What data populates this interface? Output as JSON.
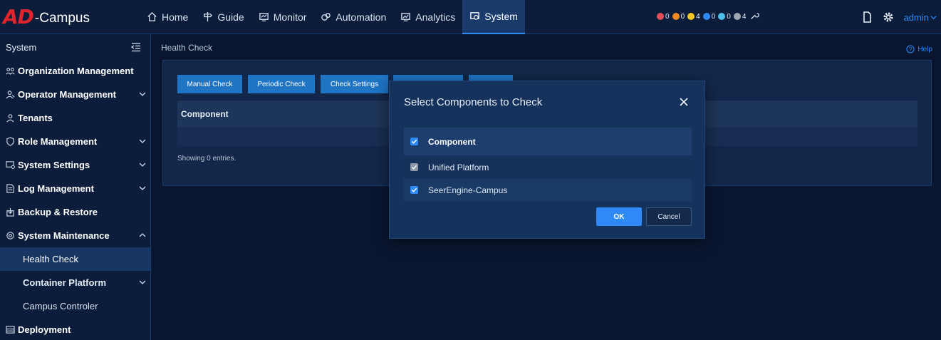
{
  "app": {
    "logo_ad": "AD",
    "logo_rest": "-Campus"
  },
  "nav": [
    {
      "label": "Home",
      "icon": "home-icon"
    },
    {
      "label": "Guide",
      "icon": "signpost-icon"
    },
    {
      "label": "Monitor",
      "icon": "monitor-icon"
    },
    {
      "label": "Automation",
      "icon": "automation-icon"
    },
    {
      "label": "Analytics",
      "icon": "analytics-icon"
    },
    {
      "label": "System",
      "icon": "system-icon",
      "active": true
    }
  ],
  "alarms": [
    {
      "count": "0",
      "color": "#e0505a"
    },
    {
      "count": "0",
      "color": "#f08a24"
    },
    {
      "count": "4",
      "color": "#f3c623"
    },
    {
      "count": "0",
      "color": "#2f8af5"
    },
    {
      "count": "0",
      "color": "#4fc1e9"
    },
    {
      "count": "4",
      "color": "#a0a8b4"
    }
  ],
  "topright": {
    "user": "admin"
  },
  "sidebar": {
    "title": "System",
    "items": [
      {
        "label": "Organization Management",
        "icon": "org-icon"
      },
      {
        "label": "Operator Management",
        "icon": "operator-icon",
        "chevron": "down"
      },
      {
        "label": "Tenants",
        "icon": "tenant-icon"
      },
      {
        "label": "Role Management",
        "icon": "role-icon",
        "chevron": "down"
      },
      {
        "label": "System Settings",
        "icon": "settings-icon",
        "chevron": "down"
      },
      {
        "label": "Log Management",
        "icon": "log-icon",
        "chevron": "down"
      },
      {
        "label": "Backup & Restore",
        "icon": "backup-icon"
      },
      {
        "label": "System Maintenance",
        "icon": "maintenance-icon",
        "chevron": "up"
      }
    ],
    "subitems": [
      {
        "label": "Health Check",
        "active": true
      },
      {
        "label": "Container Platform",
        "chevron": "down"
      },
      {
        "label": "Campus Controler"
      }
    ],
    "last": {
      "label": "Deployment",
      "icon": "deployment-icon"
    }
  },
  "main": {
    "breadcrumb": "Health Check",
    "help": "Help",
    "buttons": [
      "Manual Check",
      "Periodic Check",
      "Check Settings",
      "",
      ""
    ],
    "table_header": "Component",
    "showing": "Showing 0 entries."
  },
  "dialog": {
    "title": "Select Components to Check",
    "header": "Component",
    "rows": [
      {
        "label": "Unified Platform",
        "checked": true,
        "disabled": true
      },
      {
        "label": "SeerEngine-Campus",
        "checked": true,
        "disabled": false
      }
    ],
    "ok": "OK",
    "cancel": "Cancel"
  }
}
